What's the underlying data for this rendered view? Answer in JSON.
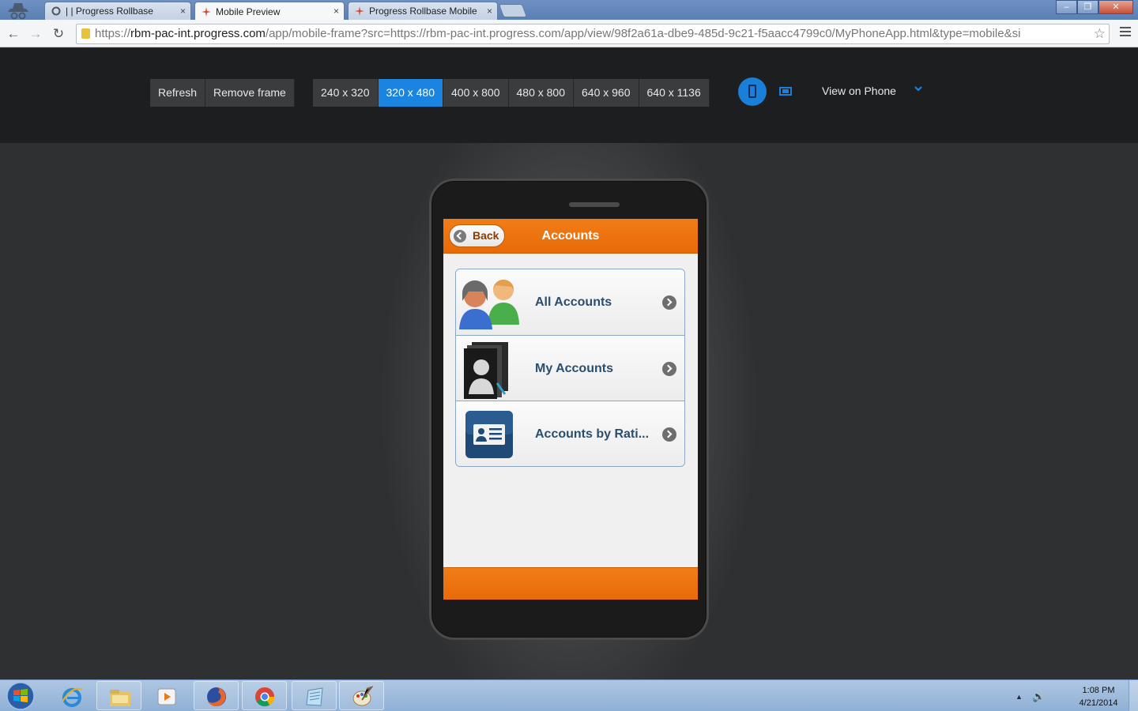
{
  "browser": {
    "tabs": [
      {
        "label": "| | Progress Rollbase",
        "close": "×"
      },
      {
        "label": "Mobile Preview",
        "close": "×"
      },
      {
        "label": "Progress Rollbase Mobile",
        "close": "×"
      }
    ],
    "window_buttons": {
      "minimize": "–",
      "maximize": "❐",
      "close": "✕"
    },
    "address": {
      "scheme": "https://",
      "host": "rbm-pac-int.progress.com",
      "path": "/app/mobile-frame?src=https://rbm-pac-int.progress.com/app/view/98f2a61a-dbe9-485d-9c21-f5aacc4799c0/MyPhoneApp.html&type=mobile&si"
    },
    "nav": {
      "back": "←",
      "forward": "→",
      "reload": "↻",
      "star": "☆"
    }
  },
  "preview_toolbar": {
    "actions": [
      {
        "label": "Refresh"
      },
      {
        "label": "Remove frame"
      }
    ],
    "sizes": [
      {
        "label": "240 x 320"
      },
      {
        "label": "320 x 480"
      },
      {
        "label": "400 x 800"
      },
      {
        "label": "480 x 800"
      },
      {
        "label": "640 x 960"
      },
      {
        "label": "640 x 1136"
      }
    ],
    "selected_size": "320 x 480",
    "view_on_phone": "View on Phone",
    "accent": "#1a84e0"
  },
  "app": {
    "back_label": "Back",
    "title": "Accounts",
    "accent": "#ec7410",
    "items": [
      {
        "label": "All Accounts",
        "icon": "users-group-icon"
      },
      {
        "label": "My Accounts",
        "icon": "user-folder-icon"
      },
      {
        "label": "Accounts by Rati...",
        "icon": "id-card-icon"
      }
    ]
  },
  "taskbar": {
    "apps": [
      "internet-explorer-icon",
      "file-explorer-icon",
      "media-player-icon",
      "firefox-icon",
      "chrome-icon",
      "notepad-icon",
      "paint-icon"
    ],
    "tray_up": "▲",
    "tray_volume": "🔊",
    "time": "1:08 PM",
    "date": "4/21/2014"
  }
}
